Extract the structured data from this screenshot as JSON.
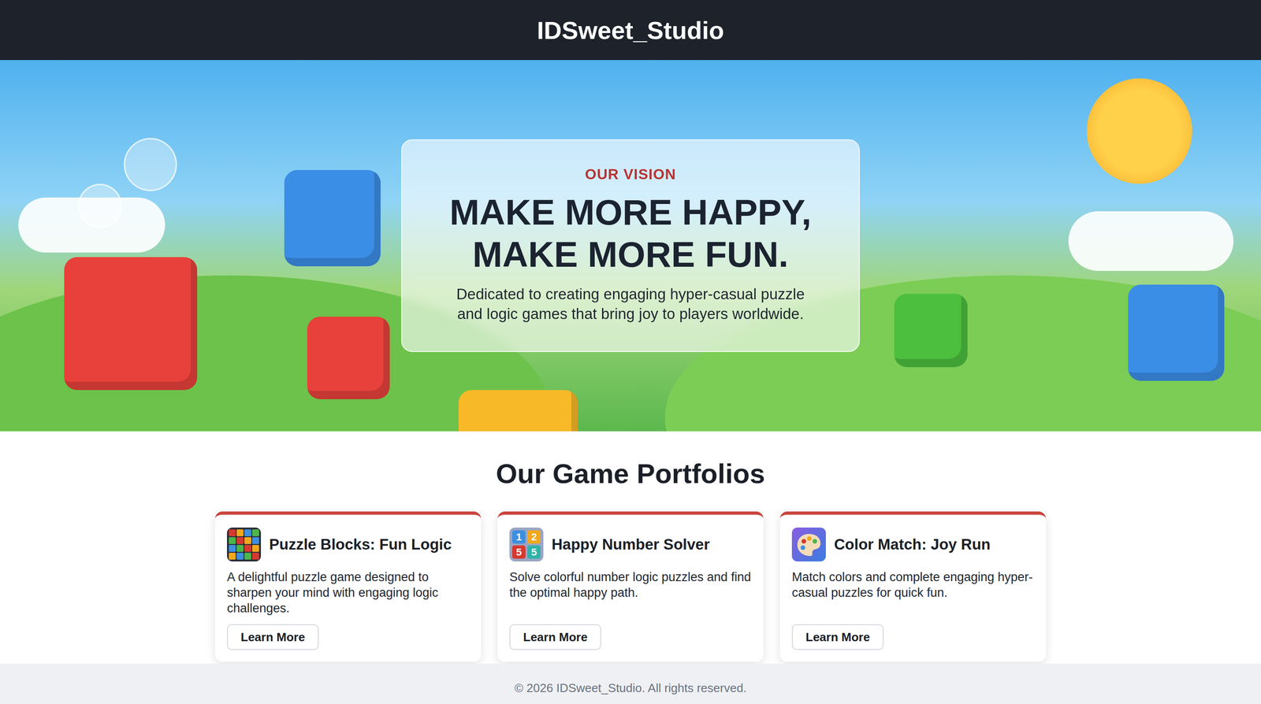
{
  "header": {
    "title": "IDSweet_Studio"
  },
  "hero": {
    "eyebrow": "OUR VISION",
    "headline_lines": [
      "MAKE MORE HAPPY,",
      "MAKE MORE FUN."
    ],
    "description": "Dedicated to creating engaging hyper-casual puzzle and logic games that bring joy to players worldwide."
  },
  "portfolio": {
    "title": "Our Game Portfolios",
    "games": [
      {
        "title": "Puzzle Blocks: Fun Logic",
        "description": "A delightful puzzle game designed to sharpen your mind with engaging logic challenges.",
        "button": "Learn More",
        "icon": {
          "kind": "blocks"
        }
      },
      {
        "title": "Happy Number Solver",
        "description": "Solve colorful number logic puzzles and find the optimal happy path.",
        "button": "Learn More",
        "icon": {
          "kind": "numbers",
          "digits": [
            "1",
            "2",
            "5",
            "5"
          ]
        }
      },
      {
        "title": "Color Match: Joy Run",
        "description": "Match colors and complete engaging hyper-casual puzzles for quick fun.",
        "button": "Learn More",
        "icon": {
          "kind": "palette"
        }
      }
    ]
  },
  "footer": {
    "text": "© 2026 IDSweet_Studio. All rights reserved."
  }
}
